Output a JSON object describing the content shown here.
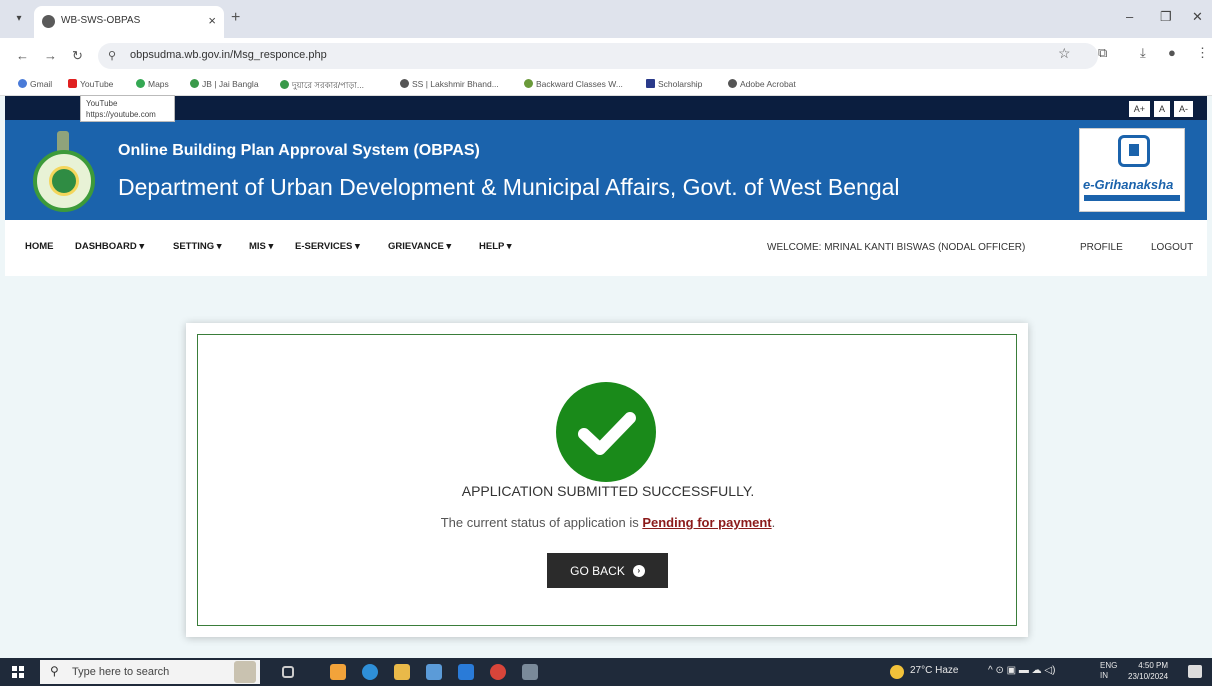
{
  "browser": {
    "tab_title": "WB-SWS-OBPAS",
    "tab_close": "×",
    "new_tab": "+",
    "url": "obpsudma.wb.gov.in/Msg_responce.php",
    "bookmarks": [
      "Gmail",
      "YouTube",
      "Maps",
      "JB | Jai Bangla",
      "দুয়ারে সরকার/পাড়া...",
      "SS | Lakshmir Bhand...",
      "Backward Classes W...",
      "Scholarship",
      "Adobe Acrobat"
    ],
    "tooltip": {
      "title": "YouTube",
      "url": "https://youtube.com"
    }
  },
  "site": {
    "font_size_buttons": [
      "A+",
      "A",
      "A-"
    ],
    "header_title": "Online Building Plan Approval System (OBPAS)",
    "header_subtitle": "Department of Urban Development & Municipal Affairs, Govt. of West Bengal",
    "logo_text": "e-Grihanaksha",
    "nav": {
      "items": [
        "HOME",
        "DASHBOARD ▾",
        "SETTING ▾",
        "MIS ▾",
        "E-SERVICES ▾",
        "GRIEVANCE ▾",
        "HELP ▾"
      ],
      "welcome": "WELCOME: MRINAL KANTI BISWAS (NODAL OFFICER)",
      "profile": "PROFILE",
      "logout": "LOGOUT"
    }
  },
  "message": {
    "title": "APPLICATION SUBMITTED SUCCESSFULLY.",
    "status_prefix": "The current status of application is ",
    "status_value": "Pending for payment",
    "status_suffix": ".",
    "button_label": "GO BACK"
  },
  "taskbar": {
    "search_placeholder": "Type here to search",
    "weather": "27°C Haze",
    "lang": "ENG",
    "region": "IN",
    "time": "4:50 PM",
    "date": "23/10/2024"
  },
  "colors": {
    "banner": "#1b63ac",
    "success": "#1a8a1a",
    "status_link": "#8b1a1a"
  }
}
